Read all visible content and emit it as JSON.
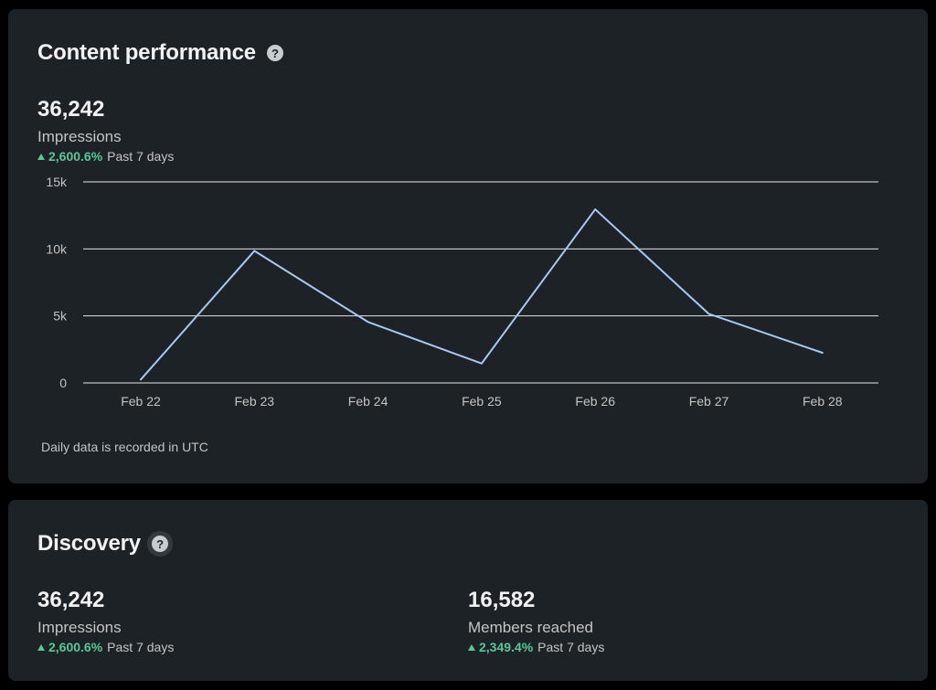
{
  "performance": {
    "title": "Content performance",
    "help_icon": "question-circle-icon",
    "metric": {
      "value": "36,242",
      "label": "Impressions",
      "change": "2,600.6%",
      "period": "Past 7 days"
    },
    "footnote": "Daily data is recorded in UTC"
  },
  "chart_data": {
    "type": "line",
    "x": [
      "Feb 22",
      "Feb 23",
      "Feb 24",
      "Feb 25",
      "Feb 26",
      "Feb 27",
      "Feb 28"
    ],
    "series": [
      {
        "values": [
          250,
          9850,
          4550,
          1450,
          12950,
          5150,
          2250
        ]
      }
    ],
    "yticks": [
      0,
      5000,
      10000,
      15000
    ],
    "ytick_labels": [
      "0",
      "5k",
      "10k",
      "15k"
    ],
    "ylim": [
      0,
      15000
    ],
    "grid": true,
    "line_color": "#a8c8f0",
    "grid_color": "#e6e6e6"
  },
  "discovery": {
    "title": "Discovery",
    "help_icon": "question-circle-icon",
    "metrics": [
      {
        "value": "36,242",
        "label": "Impressions",
        "change": "2,600.6%",
        "period": "Past 7 days"
      },
      {
        "value": "16,582",
        "label": "Members reached",
        "change": "2,349.4%",
        "period": "Past 7 days"
      }
    ]
  },
  "colors": {
    "background": "#000000",
    "card": "#1d2226",
    "positive": "#58c896",
    "text_secondary": "#c4c4c4"
  }
}
